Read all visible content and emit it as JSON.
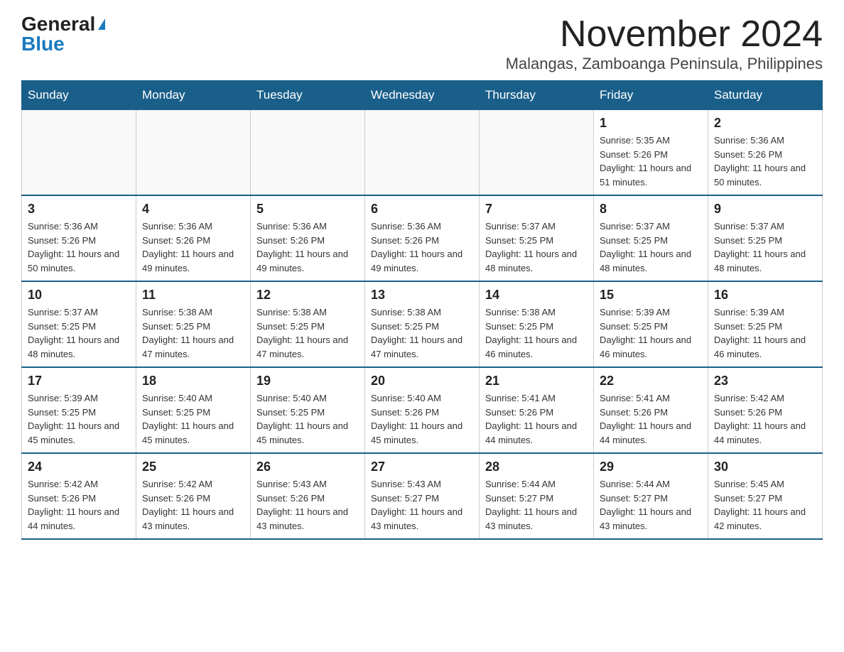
{
  "logo": {
    "general": "General",
    "blue": "Blue"
  },
  "title": "November 2024",
  "subtitle": "Malangas, Zamboanga Peninsula, Philippines",
  "calendar": {
    "headers": [
      "Sunday",
      "Monday",
      "Tuesday",
      "Wednesday",
      "Thursday",
      "Friday",
      "Saturday"
    ],
    "weeks": [
      [
        {
          "day": "",
          "info": ""
        },
        {
          "day": "",
          "info": ""
        },
        {
          "day": "",
          "info": ""
        },
        {
          "day": "",
          "info": ""
        },
        {
          "day": "",
          "info": ""
        },
        {
          "day": "1",
          "info": "Sunrise: 5:35 AM\nSunset: 5:26 PM\nDaylight: 11 hours and 51 minutes."
        },
        {
          "day": "2",
          "info": "Sunrise: 5:36 AM\nSunset: 5:26 PM\nDaylight: 11 hours and 50 minutes."
        }
      ],
      [
        {
          "day": "3",
          "info": "Sunrise: 5:36 AM\nSunset: 5:26 PM\nDaylight: 11 hours and 50 minutes."
        },
        {
          "day": "4",
          "info": "Sunrise: 5:36 AM\nSunset: 5:26 PM\nDaylight: 11 hours and 49 minutes."
        },
        {
          "day": "5",
          "info": "Sunrise: 5:36 AM\nSunset: 5:26 PM\nDaylight: 11 hours and 49 minutes."
        },
        {
          "day": "6",
          "info": "Sunrise: 5:36 AM\nSunset: 5:26 PM\nDaylight: 11 hours and 49 minutes."
        },
        {
          "day": "7",
          "info": "Sunrise: 5:37 AM\nSunset: 5:25 PM\nDaylight: 11 hours and 48 minutes."
        },
        {
          "day": "8",
          "info": "Sunrise: 5:37 AM\nSunset: 5:25 PM\nDaylight: 11 hours and 48 minutes."
        },
        {
          "day": "9",
          "info": "Sunrise: 5:37 AM\nSunset: 5:25 PM\nDaylight: 11 hours and 48 minutes."
        }
      ],
      [
        {
          "day": "10",
          "info": "Sunrise: 5:37 AM\nSunset: 5:25 PM\nDaylight: 11 hours and 48 minutes."
        },
        {
          "day": "11",
          "info": "Sunrise: 5:38 AM\nSunset: 5:25 PM\nDaylight: 11 hours and 47 minutes."
        },
        {
          "day": "12",
          "info": "Sunrise: 5:38 AM\nSunset: 5:25 PM\nDaylight: 11 hours and 47 minutes."
        },
        {
          "day": "13",
          "info": "Sunrise: 5:38 AM\nSunset: 5:25 PM\nDaylight: 11 hours and 47 minutes."
        },
        {
          "day": "14",
          "info": "Sunrise: 5:38 AM\nSunset: 5:25 PM\nDaylight: 11 hours and 46 minutes."
        },
        {
          "day": "15",
          "info": "Sunrise: 5:39 AM\nSunset: 5:25 PM\nDaylight: 11 hours and 46 minutes."
        },
        {
          "day": "16",
          "info": "Sunrise: 5:39 AM\nSunset: 5:25 PM\nDaylight: 11 hours and 46 minutes."
        }
      ],
      [
        {
          "day": "17",
          "info": "Sunrise: 5:39 AM\nSunset: 5:25 PM\nDaylight: 11 hours and 45 minutes."
        },
        {
          "day": "18",
          "info": "Sunrise: 5:40 AM\nSunset: 5:25 PM\nDaylight: 11 hours and 45 minutes."
        },
        {
          "day": "19",
          "info": "Sunrise: 5:40 AM\nSunset: 5:25 PM\nDaylight: 11 hours and 45 minutes."
        },
        {
          "day": "20",
          "info": "Sunrise: 5:40 AM\nSunset: 5:26 PM\nDaylight: 11 hours and 45 minutes."
        },
        {
          "day": "21",
          "info": "Sunrise: 5:41 AM\nSunset: 5:26 PM\nDaylight: 11 hours and 44 minutes."
        },
        {
          "day": "22",
          "info": "Sunrise: 5:41 AM\nSunset: 5:26 PM\nDaylight: 11 hours and 44 minutes."
        },
        {
          "day": "23",
          "info": "Sunrise: 5:42 AM\nSunset: 5:26 PM\nDaylight: 11 hours and 44 minutes."
        }
      ],
      [
        {
          "day": "24",
          "info": "Sunrise: 5:42 AM\nSunset: 5:26 PM\nDaylight: 11 hours and 44 minutes."
        },
        {
          "day": "25",
          "info": "Sunrise: 5:42 AM\nSunset: 5:26 PM\nDaylight: 11 hours and 43 minutes."
        },
        {
          "day": "26",
          "info": "Sunrise: 5:43 AM\nSunset: 5:26 PM\nDaylight: 11 hours and 43 minutes."
        },
        {
          "day": "27",
          "info": "Sunrise: 5:43 AM\nSunset: 5:27 PM\nDaylight: 11 hours and 43 minutes."
        },
        {
          "day": "28",
          "info": "Sunrise: 5:44 AM\nSunset: 5:27 PM\nDaylight: 11 hours and 43 minutes."
        },
        {
          "day": "29",
          "info": "Sunrise: 5:44 AM\nSunset: 5:27 PM\nDaylight: 11 hours and 43 minutes."
        },
        {
          "day": "30",
          "info": "Sunrise: 5:45 AM\nSunset: 5:27 PM\nDaylight: 11 hours and 42 minutes."
        }
      ]
    ]
  }
}
